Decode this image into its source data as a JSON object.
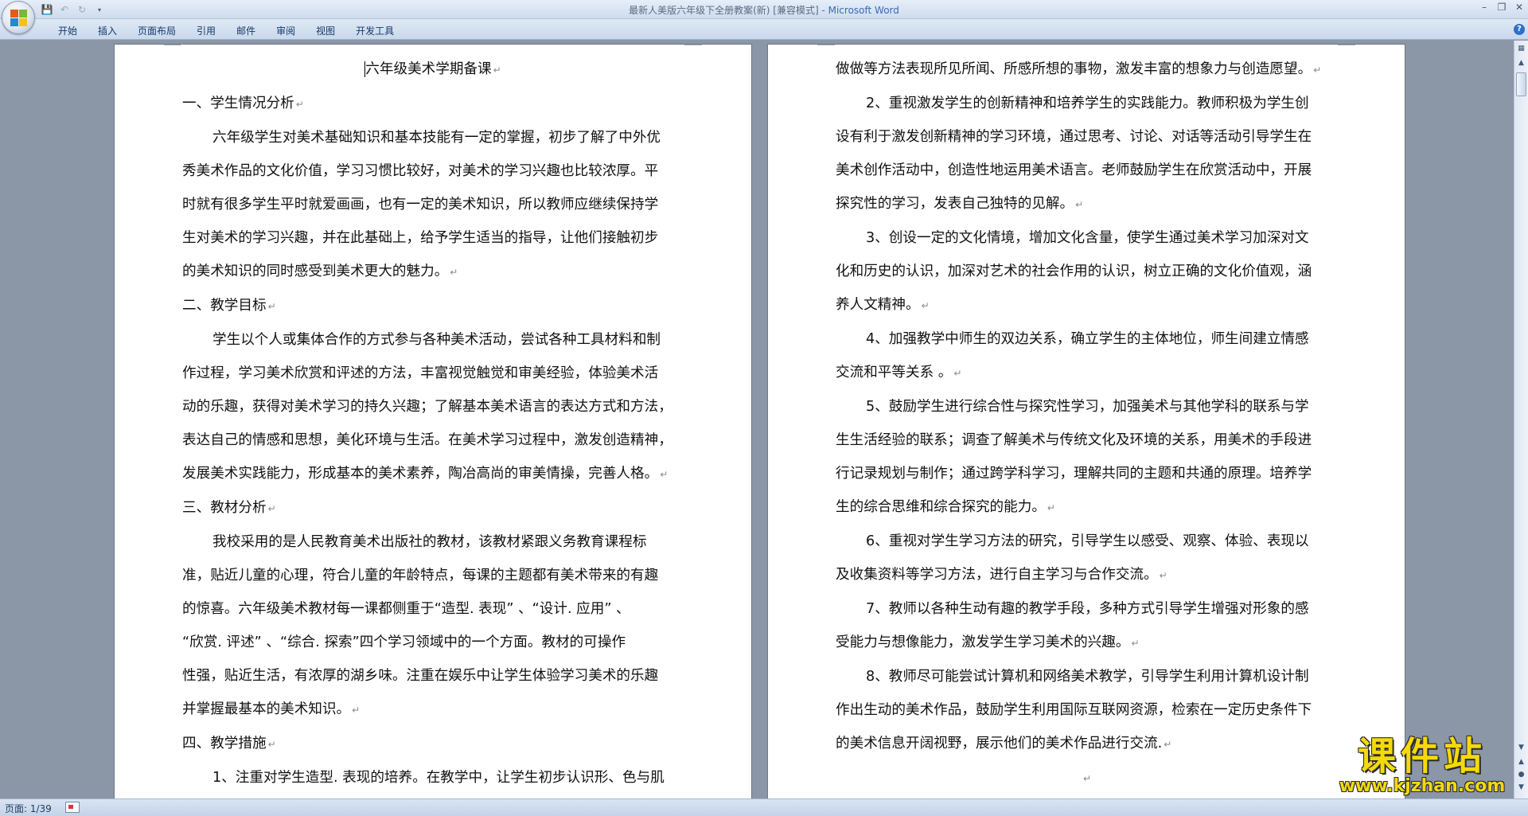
{
  "window": {
    "title_doc": "最新人美版六年级下全册教案(新) [兼容模式] - ",
    "title_app": "Microsoft Word"
  },
  "qat": {
    "save_icon": "save-icon",
    "undo_icon": "undo-icon",
    "redo_icon": "redo-icon"
  },
  "ribbon": {
    "tabs": [
      "开始",
      "插入",
      "页面布局",
      "引用",
      "邮件",
      "审阅",
      "视图",
      "开发工具"
    ],
    "help": "?"
  },
  "left_page": {
    "lines": [
      {
        "text": "六年级美术学期备课",
        "style": "center",
        "mark": "↵"
      },
      {
        "text": "一、学生情况分析",
        "style": "",
        "mark": "↵"
      },
      {
        "text": "六年级学生对美术基础知识和基本技能有一定的掌握，初步了解了中外优",
        "style": "indent",
        "mark": ""
      },
      {
        "text": "秀美术作品的文化价值，学习习惯比较好，对美术的学习兴趣也比较浓厚。平",
        "style": "",
        "mark": ""
      },
      {
        "text": "时就有很多学生平时就爱画画，也有一定的美术知识，所以教师应继续保持学",
        "style": "",
        "mark": ""
      },
      {
        "text": "生对美术的学习兴趣，并在此基础上，给予学生适当的指导，让他们接触初步",
        "style": "",
        "mark": ""
      },
      {
        "text": "的美术知识的同时感受到美术更大的魅力。",
        "style": "",
        "mark": "↵"
      },
      {
        "text": "二、教学目标",
        "style": "",
        "mark": "↵"
      },
      {
        "text": "学生以个人或集体合作的方式参与各种美术活动，尝试各种工具材料和制",
        "style": "indent",
        "mark": ""
      },
      {
        "text": "作过程，学习美术欣赏和评述的方法，丰富视觉触觉和审美经验，体验美术活",
        "style": "",
        "mark": ""
      },
      {
        "text": "动的乐趣，获得对美术学习的持久兴趣；了解基本美术语言的表达方式和方法，",
        "style": "",
        "mark": ""
      },
      {
        "text": "表达自己的情感和思想，美化环境与生活。在美术学习过程中，激发创造精神，",
        "style": "",
        "mark": ""
      },
      {
        "text": "发展美术实践能力，形成基本的美术素养，陶冶高尚的审美情操，完善人格。",
        "style": "",
        "mark": "↵"
      },
      {
        "text": "三、教材分析",
        "style": "",
        "mark": "↵"
      },
      {
        "text": "我校采用的是人民教育美术出版社的教材，该教材紧跟义务教育课程标",
        "style": "indent",
        "mark": ""
      },
      {
        "text": "准，贴近儿童的心理，符合儿童的年龄特点，每课的主题都有美术带来的有趣",
        "style": "",
        "mark": ""
      },
      {
        "text": "的惊喜。六年级美术教材每一课都侧重于“造型. 表现” 、“设计. 应用” 、",
        "style": "",
        "mark": ""
      },
      {
        "text": "“欣赏. 评述” 、“综合. 探索”四个学习领域中的一个方面。教材的可操作",
        "style": "",
        "mark": ""
      },
      {
        "text": "性强，贴近生活，有浓厚的湖乡味。注重在娱乐中让学生体验学习美术的乐趣",
        "style": "",
        "mark": ""
      },
      {
        "text": "并掌握最基本的美术知识。",
        "style": "",
        "mark": "↵"
      },
      {
        "text": "四、教学措施",
        "style": "",
        "mark": "↵"
      },
      {
        "text": "1、注重对学生造型. 表现的培养。在教学中，让学生初步认识形、色与肌",
        "style": "indent",
        "mark": ""
      }
    ]
  },
  "right_page": {
    "lines": [
      {
        "text": "做做等方法表现所见所闻、所感所想的事物，激发丰富的想象力与创造愿望。",
        "style": "",
        "mark": "↵"
      },
      {
        "text": "2、重视激发学生的创新精神和培养学生的实践能力。教师积极为学生创",
        "style": "indent",
        "mark": ""
      },
      {
        "text": "设有利于激发创新精神的学习环境，通过思考、讨论、对话等活动引导学生在",
        "style": "",
        "mark": ""
      },
      {
        "text": "美术创作活动中，创造性地运用美术语言。老师鼓励学生在欣赏活动中，开展",
        "style": "",
        "mark": ""
      },
      {
        "text": "探究性的学习，发表自己独特的见解。",
        "style": "",
        "mark": "↵"
      },
      {
        "text": "3、创设一定的文化情境，增加文化含量，使学生通过美术学习加深对文",
        "style": "indent",
        "mark": ""
      },
      {
        "text": "化和历史的认识，加深对艺术的社会作用的认识，树立正确的文化价值观，涵",
        "style": "",
        "mark": ""
      },
      {
        "text": "养人文精神。",
        "style": "",
        "mark": "↵"
      },
      {
        "text": "4、加强教学中师生的双边关系，确立学生的主体地位，师生间建立情感",
        "style": "indent",
        "mark": ""
      },
      {
        "text": "交流和平等关系 。",
        "style": "",
        "mark": "↵"
      },
      {
        "text": "5、鼓励学生进行综合性与探究性学习，加强美术与其他学科的联系与学",
        "style": "indent",
        "mark": ""
      },
      {
        "text": "生生活经验的联系；调查了解美术与传统文化及环境的关系，用美术的手段进",
        "style": "",
        "mark": ""
      },
      {
        "text": "行记录规划与制作；通过跨学科学习，理解共同的主题和共通的原理。培养学",
        "style": "",
        "mark": ""
      },
      {
        "text": "生的综合思维和综合探究的能力。",
        "style": "",
        "mark": "↵"
      },
      {
        "text": "6、重视对学生学习方法的研究，引导学生以感受、观察、体验、表现以",
        "style": "indent",
        "mark": ""
      },
      {
        "text": "及收集资料等学习方法，进行自主学习与合作交流。",
        "style": "",
        "mark": "↵"
      },
      {
        "text": "7、教师以各种生动有趣的教学手段，多种方式引导学生增强对形象的感",
        "style": "indent",
        "mark": ""
      },
      {
        "text": "受能力与想像能力，激发学生学习美术的兴趣。",
        "style": "",
        "mark": "↵"
      },
      {
        "text": "8、教师尽可能尝试计算机和网络美术教学，引导学生利用计算机设计制",
        "style": "indent",
        "mark": ""
      },
      {
        "text": "作出生动的美术作品，鼓励学生利用国际互联网资源，检索在一定历史条件下",
        "style": "",
        "mark": ""
      },
      {
        "text": "的美术信息开阔视野，展示他们的美术作品进行交流.",
        "style": "",
        "mark": "↵"
      },
      {
        "text": "",
        "style": "center",
        "mark": "↵"
      },
      {
        "text": "",
        "style": "center",
        "mark": "↵"
      }
    ]
  },
  "status": {
    "page": "页面: 1/39"
  },
  "watermark": {
    "cn": "课件站",
    "url": "www.kjzhan.com"
  }
}
